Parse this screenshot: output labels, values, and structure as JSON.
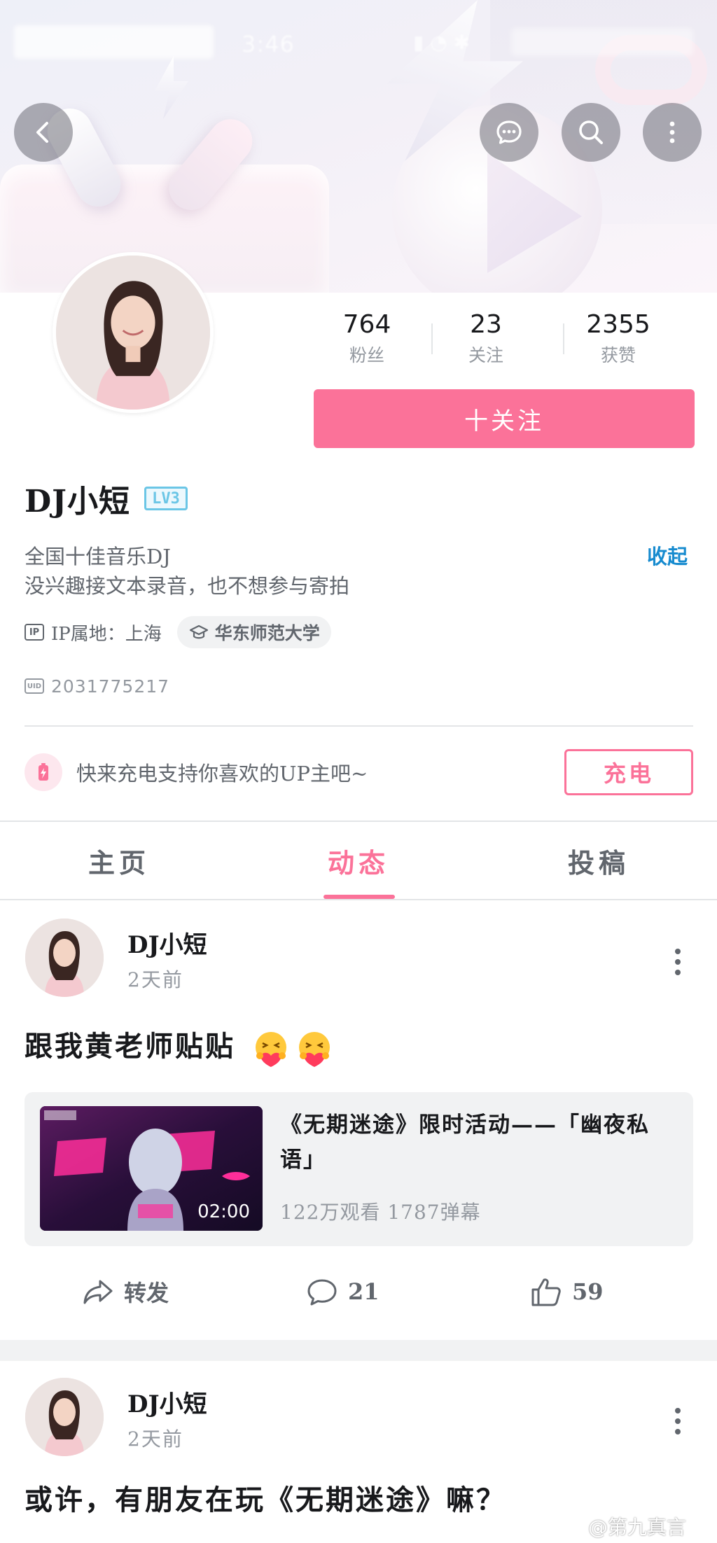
{
  "status_bar": {
    "time": "3:46"
  },
  "profile": {
    "stats": [
      {
        "value": "764",
        "label": "粉丝"
      },
      {
        "value": "23",
        "label": "关注"
      },
      {
        "value": "2355",
        "label": "获赞"
      }
    ],
    "follow_label": "十关注",
    "username": "DJ小短",
    "level": "LV3",
    "bio_lines": [
      "全国十佳音乐DJ",
      "没兴趣接文本录音，也不想参与寄拍"
    ],
    "collapse_label": "收起",
    "ip_badge": "IP",
    "ip_location": "IP属地：上海",
    "school": "华东师范大学",
    "uid_badge": "UID",
    "uid": "2031775217"
  },
  "charge": {
    "prompt": "快来充电支持你喜欢的UP主吧~",
    "button_label": "充电"
  },
  "tabs": [
    {
      "label": "主页",
      "active": false
    },
    {
      "label": "动态",
      "active": true
    },
    {
      "label": "投稿",
      "active": false
    }
  ],
  "posts": [
    {
      "author": "DJ小短",
      "time": "2天前",
      "text": "跟我黄老师贴贴",
      "video": {
        "title": "《无期迷途》限时活动——「幽夜私语」",
        "duration": "02:00",
        "stats": "122万观看  1787弹幕"
      },
      "actions": {
        "repost": "转发",
        "comments": "21",
        "likes": "59"
      }
    },
    {
      "author": "DJ小短",
      "time": "2天前",
      "text": "或许，有朋友在玩《无期迷途》嘛？"
    }
  ],
  "watermark": "@第九真言",
  "colors": {
    "accent": "#fb7299",
    "link": "#178bcf",
    "level": "#6bc6e6"
  }
}
